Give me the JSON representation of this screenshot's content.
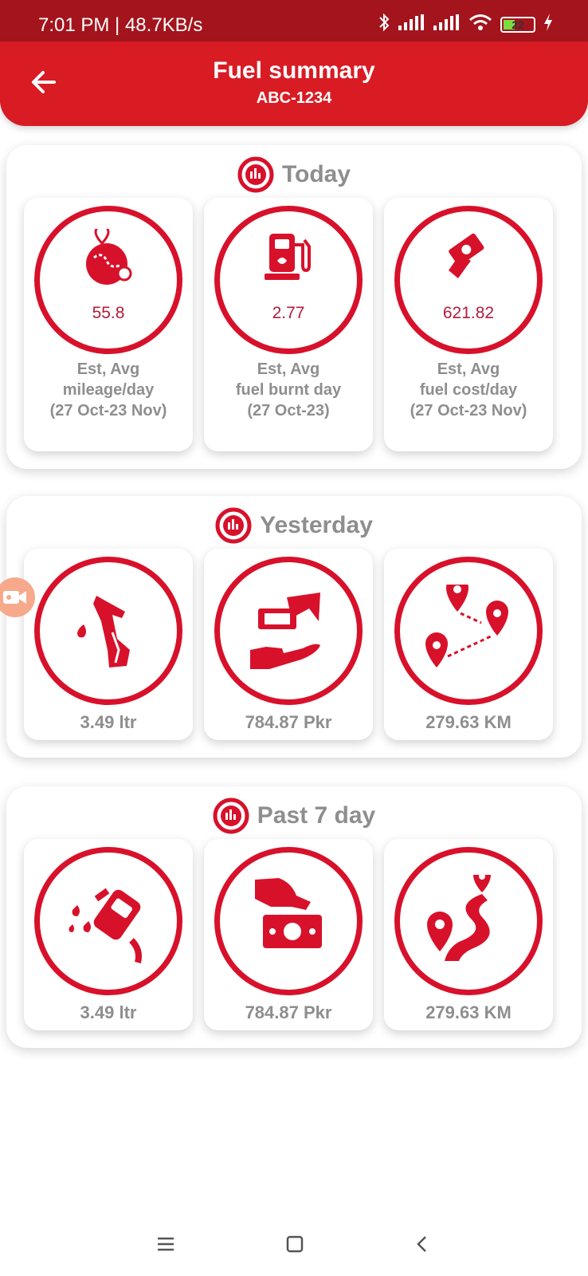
{
  "status_bar": {
    "time": "7:01 PM | 48.7KB/s",
    "battery": "22"
  },
  "header": {
    "title": "Fuel summary",
    "subtitle": "ABC-1234"
  },
  "today": {
    "title": "Today",
    "cards": [
      {
        "value": "55.8",
        "desc_line1": "Est, Avg",
        "desc_line2": "mileage/day",
        "desc_line3": "(27 Oct-23 Nov)"
      },
      {
        "value": "2.77",
        "desc_line1": "Est, Avg",
        "desc_line2": "fuel burnt day",
        "desc_line3": "(27 Oct-23)"
      },
      {
        "value": "621.82",
        "desc_line1": "Est, Avg",
        "desc_line2": "fuel cost/day",
        "desc_line3": "(27 Oct-23 Nov)"
      }
    ]
  },
  "yesterday": {
    "title": "Yesterday",
    "cards": [
      {
        "value": "3.49 ltr"
      },
      {
        "value": "784.87 Pkr"
      },
      {
        "value": "279.63 KM"
      }
    ]
  },
  "past7": {
    "title": "Past 7 day",
    "cards": [
      {
        "value": "3.49 ltr"
      },
      {
        "value": "784.87 Pkr"
      },
      {
        "value": "279.63 KM"
      }
    ]
  },
  "colors": {
    "accent": "#d91b24",
    "status_bar": "#a3141d",
    "ring": "#d8112b",
    "muted_text": "#8e8e8e"
  }
}
